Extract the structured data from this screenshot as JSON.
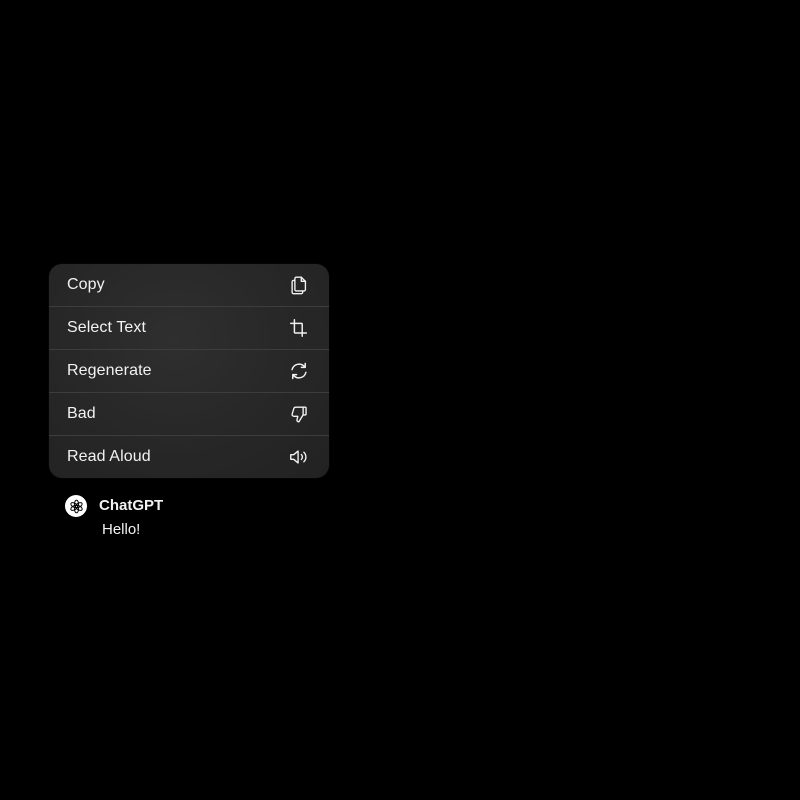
{
  "menu": {
    "items": [
      {
        "label": "Copy",
        "icon": "copy-icon"
      },
      {
        "label": "Select Text",
        "icon": "crop-icon"
      },
      {
        "label": "Regenerate",
        "icon": "refresh-icon"
      },
      {
        "label": "Bad",
        "icon": "thumbs-down-icon"
      },
      {
        "label": "Read Aloud",
        "icon": "speaker-icon"
      }
    ]
  },
  "message": {
    "sender": "ChatGPT",
    "text": "Hello!",
    "avatar_icon": "chatgpt-logo-icon"
  },
  "colors": {
    "background": "#000000",
    "menu_background": "#282828",
    "text": "#f2f2f2"
  }
}
